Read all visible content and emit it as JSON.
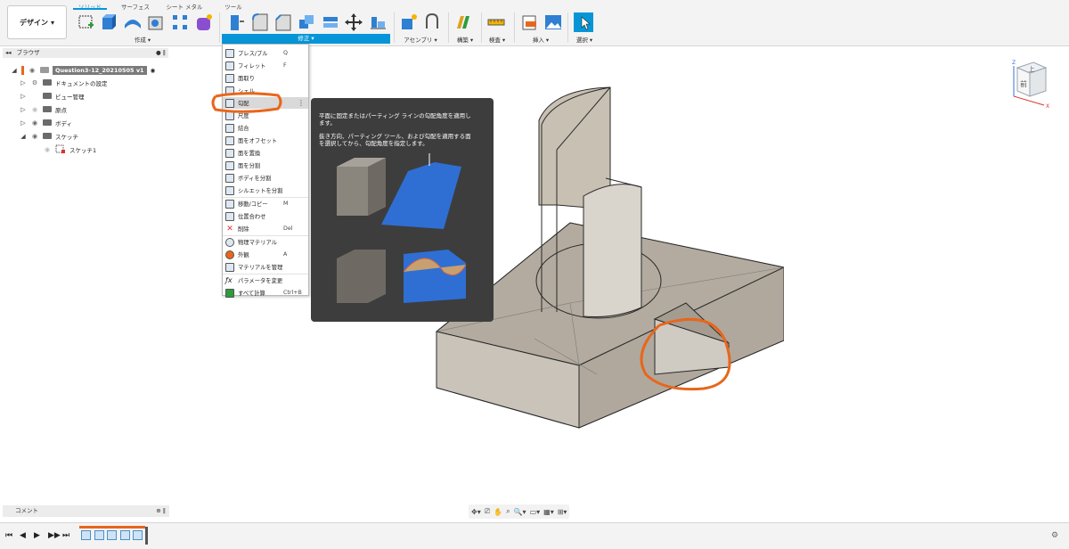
{
  "workspace_button": {
    "label": "デザイン",
    "icon": "chevron-down-icon"
  },
  "tabs": [
    {
      "label": "ソリッド",
      "active": true
    },
    {
      "label": "サーフェス",
      "active": false
    },
    {
      "label": "シート メタル",
      "active": false
    },
    {
      "label": "ツール",
      "active": false
    }
  ],
  "toolbar_groups": {
    "create": "作成 ▾",
    "modify": "修正 ▾",
    "assemble": "アセンブリ ▾",
    "construct": "構築 ▾",
    "inspect": "検査 ▾",
    "insert": "挿入 ▾",
    "select": "選択 ▾"
  },
  "browser": {
    "title": "ブラウザ",
    "root": "Question3-12_20210505 v1",
    "items": [
      {
        "label": "ドキュメントの設定"
      },
      {
        "label": "ビュー管理"
      },
      {
        "label": "原点"
      },
      {
        "label": "ボディ"
      },
      {
        "label": "スケッチ"
      },
      {
        "label": "スケッチ1"
      }
    ]
  },
  "modify_menu": {
    "items": [
      {
        "label": "プレス/プル",
        "shortcut": "Q"
      },
      {
        "label": "フィレット",
        "shortcut": "F"
      },
      {
        "label": "面取り",
        "shortcut": ""
      },
      {
        "label": "シェル",
        "shortcut": ""
      },
      {
        "label": "勾配",
        "shortcut": ""
      },
      {
        "label": "尺度",
        "shortcut": ""
      },
      {
        "label": "結合",
        "shortcut": ""
      },
      {
        "label": "面をオフセット",
        "shortcut": ""
      },
      {
        "label": "面を置換",
        "shortcut": ""
      },
      {
        "label": "面を分割",
        "shortcut": ""
      },
      {
        "label": "ボディを分割",
        "shortcut": ""
      },
      {
        "label": "シルエットを分割",
        "shortcut": ""
      },
      {
        "label": "移動/コピー",
        "shortcut": "M"
      },
      {
        "label": "位置合わせ",
        "shortcut": ""
      },
      {
        "label": "削除",
        "shortcut": "Del"
      },
      {
        "label": "物理マテリアル",
        "shortcut": ""
      },
      {
        "label": "外観",
        "shortcut": "A"
      },
      {
        "label": "マテリアルを管理",
        "shortcut": ""
      },
      {
        "label": "パラメータを変更",
        "shortcut": ""
      },
      {
        "label": "すべて計算",
        "shortcut": "Ctrl+B"
      }
    ]
  },
  "tooltip": {
    "line1": "平面に固定またはパーティング ラインの勾配角度を適用し",
    "line2": "ます。",
    "line3": "抜き方向、パーティング ツール、および勾配を適用する面",
    "line4": "を選択してから、勾配角度を指定します。"
  },
  "viewcube": {
    "top_label": "上",
    "front_label": "前",
    "axis_z": "Z",
    "axis_x": "X"
  },
  "comment_panel": {
    "title": "コメント"
  },
  "colors": {
    "accent": "#0696d7",
    "annotation": "#e8661b",
    "tooltip_bg": "#3d3d3d",
    "model_face": "#b8b0a4"
  }
}
